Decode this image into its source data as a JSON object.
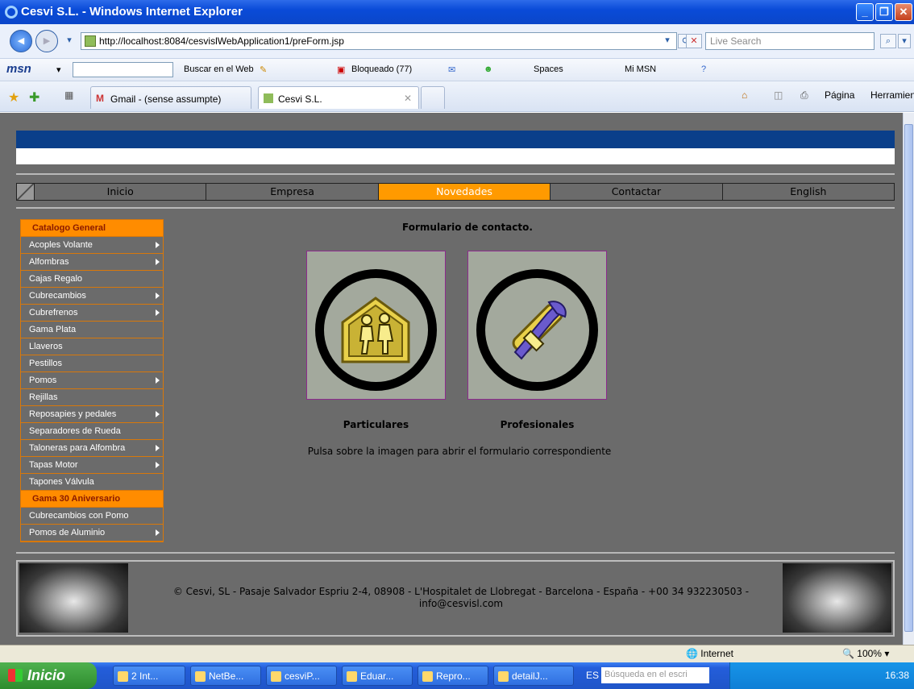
{
  "window": {
    "title": "Cesvi S.L. - Windows Internet Explorer"
  },
  "browser": {
    "address": "http://localhost:8084/cesvislWebApplication1/preForm.jsp",
    "search_placeholder": "Live Search",
    "msn_toolbar": {
      "logo": "msn",
      "search_web": "Buscar en el Web",
      "blocked": "Bloqueado (77)",
      "spaces": "Spaces",
      "mimsn": "Mi MSN"
    },
    "tabs": [
      {
        "label": "Gmail - (sense assumpte)"
      },
      {
        "label": "Cesvi S.L."
      }
    ],
    "command_bar": {
      "page": "Página",
      "tools": "Herramientas"
    },
    "status": {
      "zone": "Internet",
      "zoom": "100%"
    }
  },
  "site": {
    "nav": [
      {
        "label": "Inicio",
        "active": false
      },
      {
        "label": "Empresa",
        "active": false
      },
      {
        "label": "Novedades",
        "active": true
      },
      {
        "label": "Contactar",
        "active": false
      },
      {
        "label": "English",
        "active": false
      }
    ],
    "sidebar": [
      {
        "label": "Catalogo General",
        "header": true,
        "submenu": false
      },
      {
        "label": "Acoples Volante",
        "header": false,
        "submenu": true
      },
      {
        "label": "Alfombras",
        "header": false,
        "submenu": true
      },
      {
        "label": "Cajas Regalo",
        "header": false,
        "submenu": false
      },
      {
        "label": "Cubrecambios",
        "header": false,
        "submenu": true
      },
      {
        "label": "Cubrefrenos",
        "header": false,
        "submenu": true
      },
      {
        "label": "Gama Plata",
        "header": false,
        "submenu": false
      },
      {
        "label": "Llaveros",
        "header": false,
        "submenu": false
      },
      {
        "label": "Pestillos",
        "header": false,
        "submenu": false
      },
      {
        "label": "Pomos",
        "header": false,
        "submenu": true
      },
      {
        "label": "Rejillas",
        "header": false,
        "submenu": false
      },
      {
        "label": "Reposapies y pedales",
        "header": false,
        "submenu": true
      },
      {
        "label": "Separadores de Rueda",
        "header": false,
        "submenu": false
      },
      {
        "label": "Taloneras para Alfombra",
        "header": false,
        "submenu": true
      },
      {
        "label": "Tapas Motor",
        "header": false,
        "submenu": true
      },
      {
        "label": "Tapones Válvula",
        "header": false,
        "submenu": false
      },
      {
        "label": "Gama 30 Aniversario",
        "header": true,
        "submenu": false
      },
      {
        "label": "Cubrecambios con Pomo",
        "header": false,
        "submenu": false
      },
      {
        "label": "Pomos de Aluminio",
        "header": false,
        "submenu": true
      }
    ],
    "form_title": "Formulario de contacto.",
    "options": [
      {
        "caption": "Particulares",
        "icon": "school-children-icon"
      },
      {
        "caption": "Profesionales",
        "icon": "wrench-brush-icon"
      }
    ],
    "hint": "Pulsa sobre la imagen para abrir el formulario correspondiente",
    "footer": "© Cesvi, SL - Pasaje Salvador Espriu 2-4, 08908 - L'Hospitalet de Llobregat - Barcelona - España - +00 34 932230503 - info@cesvisl.com"
  },
  "taskbar": {
    "start": "Inicio",
    "items": [
      "2 Int...",
      "NetBe...",
      "cesviP...",
      "Eduar...",
      "Repro...",
      "detailJ..."
    ],
    "lang": "ES",
    "search_placeholder": "Búsqueda en el escri",
    "clock": "16:38"
  },
  "colors": {
    "accent_orange": "#ff9a00",
    "site_bg": "#6b6b6b",
    "header_blue": "#0a3f8a"
  }
}
